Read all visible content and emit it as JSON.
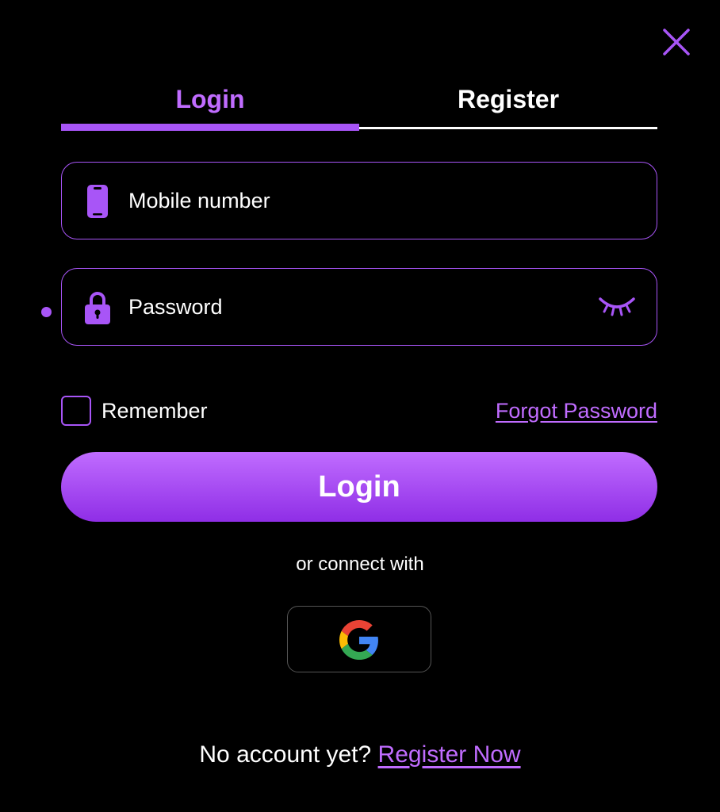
{
  "colors": {
    "accent": "#a855f7",
    "accent_light": "#c06cff",
    "accent_dark": "#8f2ee6",
    "background": "#000000",
    "text": "#ffffff",
    "border_muted": "#555555"
  },
  "header": {
    "close_icon": "close-icon"
  },
  "tabs": [
    {
      "label": "Login",
      "active": true
    },
    {
      "label": "Register",
      "active": false
    }
  ],
  "form": {
    "mobile": {
      "placeholder": "Mobile number",
      "icon": "phone-icon"
    },
    "password": {
      "placeholder": "Password",
      "icon": "lock-icon",
      "toggle_icon": "eye-closed-icon"
    },
    "remember_label": "Remember",
    "forgot_label": "Forgot Password",
    "submit_label": "Login"
  },
  "social": {
    "divider_text": "or connect with",
    "providers": [
      {
        "name": "Google",
        "icon": "google-icon"
      }
    ]
  },
  "footer": {
    "prompt": "No account yet?",
    "link_label": "Register Now"
  }
}
